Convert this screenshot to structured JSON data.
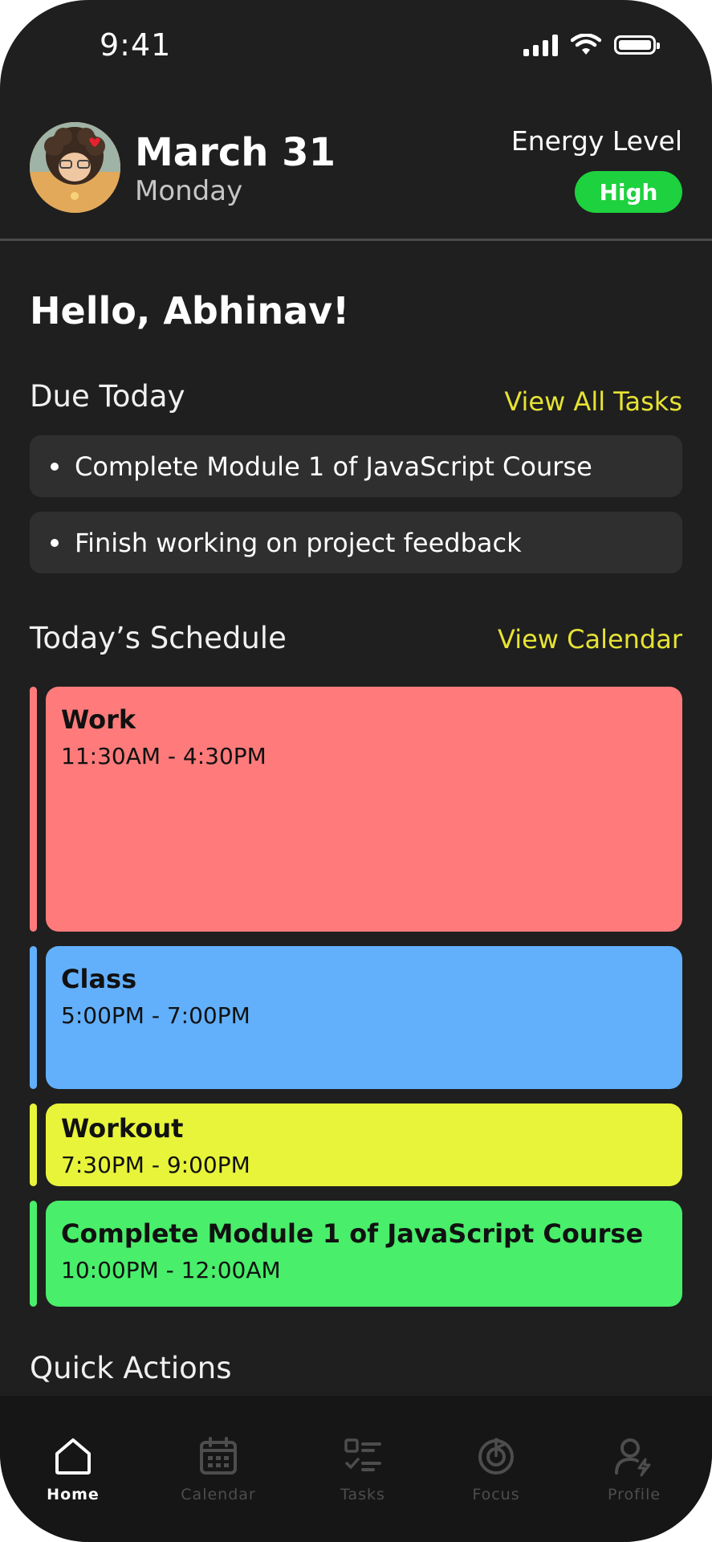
{
  "status_bar": {
    "time": "9:41"
  },
  "header": {
    "date": "March 31",
    "weekday": "Monday",
    "energy_label": "Energy Level",
    "energy_value": "High"
  },
  "greeting": "Hello, Abhinav!",
  "due_today": {
    "title": "Due Today",
    "link": "View All Tasks",
    "tasks": [
      "Complete Module 1 of JavaScript Course",
      "Finish working on project feedback"
    ]
  },
  "schedule": {
    "title": "Today’s Schedule",
    "link": "View Calendar",
    "events": [
      {
        "title": "Work",
        "time": "11:30AM - 4:30PM",
        "color": "#ff7b7b"
      },
      {
        "title": "Class",
        "time": "5:00PM - 7:00PM",
        "color": "#62b0fc"
      },
      {
        "title": "Workout",
        "time": "7:30PM - 9:00PM",
        "color": "#e8f43a"
      },
      {
        "title": "Complete Module 1 of JavaScript Course",
        "time": "10:00PM - 12:00AM",
        "color": "#49ee6b"
      }
    ]
  },
  "quick_actions": {
    "title": "Quick Actions"
  },
  "tabbar": {
    "items": [
      {
        "label": "Home",
        "icon": "home-icon",
        "active": true
      },
      {
        "label": "Calendar",
        "icon": "calendar-icon",
        "active": false
      },
      {
        "label": "Tasks",
        "icon": "tasks-icon",
        "active": false
      },
      {
        "label": "Focus",
        "icon": "focus-icon",
        "active": false
      },
      {
        "label": "Profile",
        "icon": "profile-icon",
        "active": false
      }
    ]
  },
  "colors": {
    "background": "#1f1f1f",
    "accent_link": "#e6e334",
    "energy_badge": "#1ed13e"
  }
}
